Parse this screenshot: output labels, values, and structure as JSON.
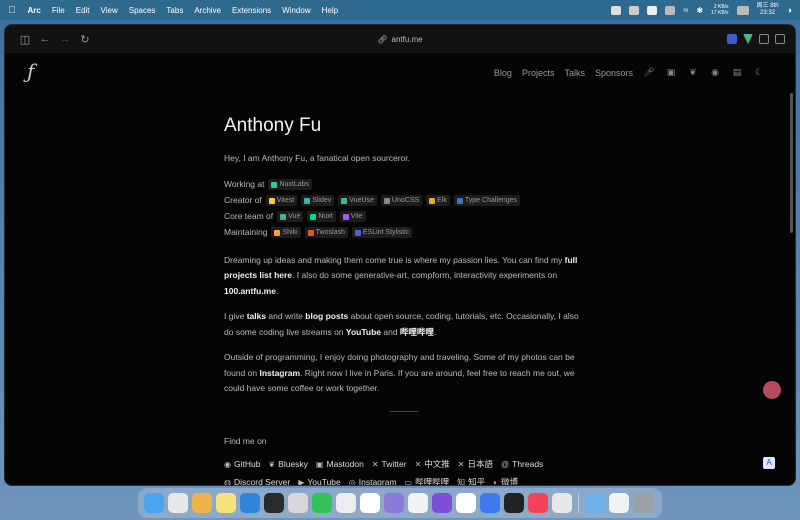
{
  "menubar": {
    "app": "Arc",
    "items": [
      "File",
      "Edit",
      "View",
      "Spaces",
      "Tabs",
      "Archive",
      "Extensions",
      "Window",
      "Help"
    ],
    "net_up": "2 KB/s",
    "net_down": "17 KB/s",
    "date": "周三 8th",
    "time": "23:32"
  },
  "toolbar": {
    "url": "antfu.me"
  },
  "site": {
    "logo": "ƒ",
    "nav": [
      "Blog",
      "Projects",
      "Talks",
      "Sponsors"
    ]
  },
  "content": {
    "title": "Anthony Fu",
    "intro": "Hey, I am Anthony Fu, a fanatical open sourceror.",
    "roles": [
      {
        "label": "Working at",
        "chips": [
          {
            "name": "NuxtLabs",
            "color": "#2fd08a"
          }
        ]
      },
      {
        "label": "Creator of",
        "chips": [
          {
            "name": "Vitest",
            "color": "#f7c948"
          },
          {
            "name": "Slidev",
            "color": "#3ab4a4"
          },
          {
            "name": "VueUse",
            "color": "#41b883"
          },
          {
            "name": "UnoCSS",
            "color": "#888888"
          },
          {
            "name": "Elk",
            "color": "#e8a33a"
          },
          {
            "name": "Type Challenges",
            "color": "#3178c6"
          }
        ]
      },
      {
        "label": "Core team of",
        "chips": [
          {
            "name": "Vue",
            "color": "#41b883"
          },
          {
            "name": "Nuxt",
            "color": "#00dc82"
          },
          {
            "name": "Vite",
            "color": "#a855f7"
          }
        ]
      },
      {
        "label": "Maintaining",
        "chips": [
          {
            "name": "Shiki",
            "color": "#f2a641"
          },
          {
            "name": "Twoslash",
            "color": "#e0562c"
          },
          {
            "name": "ESLint Stylistic",
            "color": "#4b5ed6"
          }
        ]
      }
    ],
    "p1_a": "Dreaming up ideas and making them come true is where my passion lies. You can find my ",
    "p1_link1": "full projects list here",
    "p1_b": ". I also do some generative-art, compform, interactivity experiments on ",
    "p1_link2": "100.antfu.me",
    "p1_c": ".",
    "p2_a": "I give ",
    "p2_link1": "talks",
    "p2_b": " and write ",
    "p2_link2": "blog posts",
    "p2_c": " about open source, coding, tutorials, etc. Occasionally, I also do some coding live streams on ",
    "p2_link3": "YouTube",
    "p2_d": " and ",
    "p2_link4": "哔哩哔哩",
    "p2_e": ".",
    "p3_a": "Outside of programming, I enjoy doing photography and traveling. Some of my photos can be found on ",
    "p3_link1": "Instagram",
    "p3_b": ". Right now I live in Paris. If you are around, feel free to reach me out, we could have some coffee or work together.",
    "find_me": "Find me on",
    "social": [
      {
        "name": "GitHub",
        "icon": "github-icon",
        "glyph": "◉"
      },
      {
        "name": "Bluesky",
        "icon": "bluesky-icon",
        "glyph": "❦"
      },
      {
        "name": "Mastodon",
        "icon": "mastodon-icon",
        "glyph": "▣"
      },
      {
        "name": "Twitter",
        "icon": "x-icon",
        "glyph": "✕"
      },
      {
        "name": "中文推",
        "icon": "x-icon",
        "glyph": "✕"
      },
      {
        "name": "日本語",
        "icon": "x-icon",
        "glyph": "✕"
      },
      {
        "name": "Threads",
        "icon": "threads-icon",
        "glyph": "@"
      },
      {
        "name": "Discord Server",
        "icon": "discord-icon",
        "glyph": "◍"
      },
      {
        "name": "YouTube",
        "icon": "youtube-icon",
        "glyph": "▶"
      },
      {
        "name": "Instagram",
        "icon": "instagram-icon",
        "glyph": "◎"
      },
      {
        "name": "哔哩哔哩",
        "icon": "bilibili-icon",
        "glyph": "▭"
      },
      {
        "name": "知乎",
        "icon": "zhihu-icon",
        "glyph": "知"
      },
      {
        "name": "微博",
        "icon": "weibo-icon",
        "glyph": "◐"
      }
    ]
  },
  "dock": {
    "apps": [
      {
        "name": "finder",
        "color": "#4aa3f0"
      },
      {
        "name": "launchpad",
        "color": "#e8e8e8"
      },
      {
        "name": "arc",
        "color": "#f0b24a"
      },
      {
        "name": "notes",
        "color": "#f7e27a"
      },
      {
        "name": "vscode",
        "color": "#2f86d6"
      },
      {
        "name": "webstorm",
        "color": "#2b2b2b"
      },
      {
        "name": "pencil",
        "color": "#d8d8d8"
      },
      {
        "name": "wechat",
        "color": "#31c25a"
      },
      {
        "name": "messages",
        "color": "#ededed"
      },
      {
        "name": "notion",
        "color": "#ffffff"
      },
      {
        "name": "obs",
        "color": "#8c7bd6"
      },
      {
        "name": "calendar",
        "color": "#f3f3f3"
      },
      {
        "name": "obsidian",
        "color": "#7d4fd6"
      },
      {
        "name": "qq",
        "color": "#ffffff"
      },
      {
        "name": "feishu",
        "color": "#3d7af0"
      },
      {
        "name": "terminal",
        "color": "#222222"
      },
      {
        "name": "music",
        "color": "#f54259"
      },
      {
        "name": "chrome",
        "color": "#e8e8e8"
      },
      {
        "name": "downloads-folder",
        "color": "#6fb2ee"
      },
      {
        "name": "preview",
        "color": "#f2f2f2"
      },
      {
        "name": "trash",
        "color": "#9aa0a8"
      }
    ]
  }
}
